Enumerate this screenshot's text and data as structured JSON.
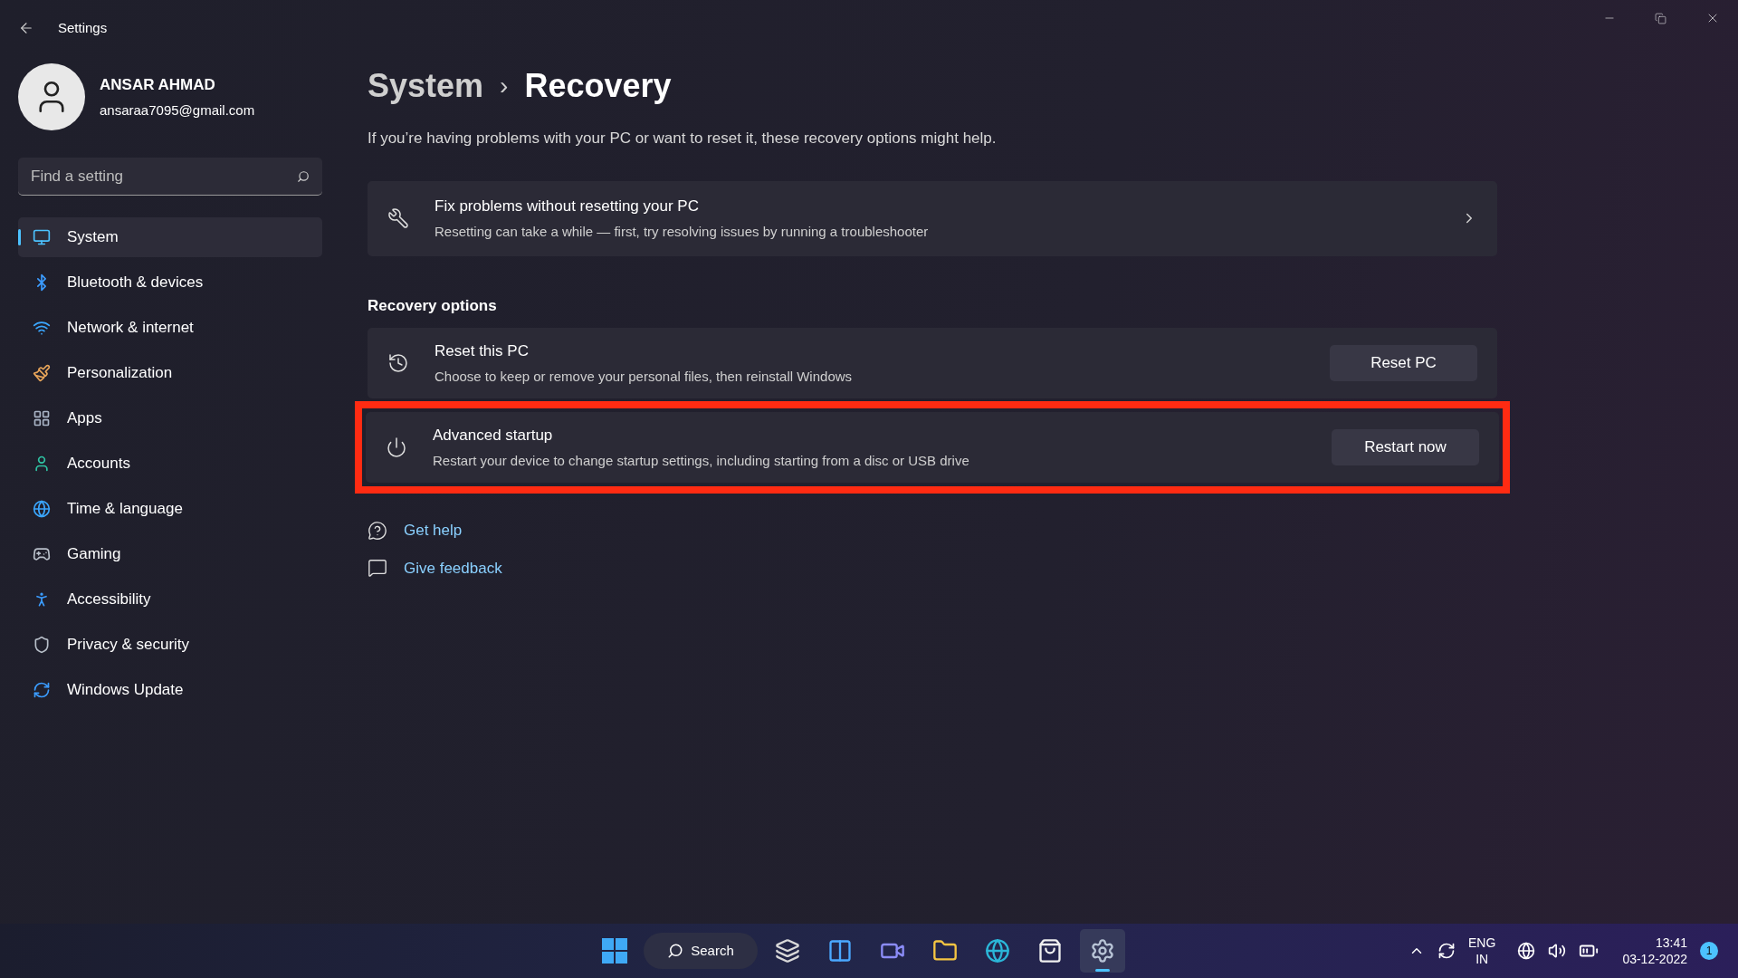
{
  "window": {
    "title": "Settings"
  },
  "user": {
    "name": "ANSAR AHMAD",
    "email": "ansaraa7095@gmail.com"
  },
  "search": {
    "placeholder": "Find a setting"
  },
  "sidebar": {
    "items": [
      {
        "label": "System",
        "selected": true
      },
      {
        "label": "Bluetooth & devices",
        "selected": false
      },
      {
        "label": "Network & internet",
        "selected": false
      },
      {
        "label": "Personalization",
        "selected": false
      },
      {
        "label": "Apps",
        "selected": false
      },
      {
        "label": "Accounts",
        "selected": false
      },
      {
        "label": "Time & language",
        "selected": false
      },
      {
        "label": "Gaming",
        "selected": false
      },
      {
        "label": "Accessibility",
        "selected": false
      },
      {
        "label": "Privacy & security",
        "selected": false
      },
      {
        "label": "Windows Update",
        "selected": false
      }
    ]
  },
  "breadcrumb": {
    "parent": "System",
    "separator": "›",
    "current": "Recovery"
  },
  "description": "If you’re having problems with your PC or want to reset it, these recovery options might help.",
  "fix_card": {
    "title": "Fix problems without resetting your PC",
    "subtitle": "Resetting can take a while — first, try resolving issues by running a troubleshooter"
  },
  "section_title": "Recovery options",
  "options": [
    {
      "title": "Reset this PC",
      "subtitle": "Choose to keep or remove your personal files, then reinstall Windows",
      "button": "Reset PC",
      "highlighted": false
    },
    {
      "title": "Advanced startup",
      "subtitle": "Restart your device to change startup settings, including starting from a disc or USB drive",
      "button": "Restart now",
      "highlighted": true
    }
  ],
  "links": [
    "Get help",
    "Give feedback"
  ],
  "taskbar": {
    "search_label": "Search",
    "apps": [
      {
        "selected": false
      },
      {
        "selected": false
      },
      {
        "selected": false
      },
      {
        "selected": false
      },
      {
        "selected": false
      },
      {
        "selected": false
      },
      {
        "selected": true
      }
    ],
    "language": "ENG",
    "region": "IN",
    "time": "13:41",
    "date": "03-12-2022",
    "notifications": "1"
  }
}
